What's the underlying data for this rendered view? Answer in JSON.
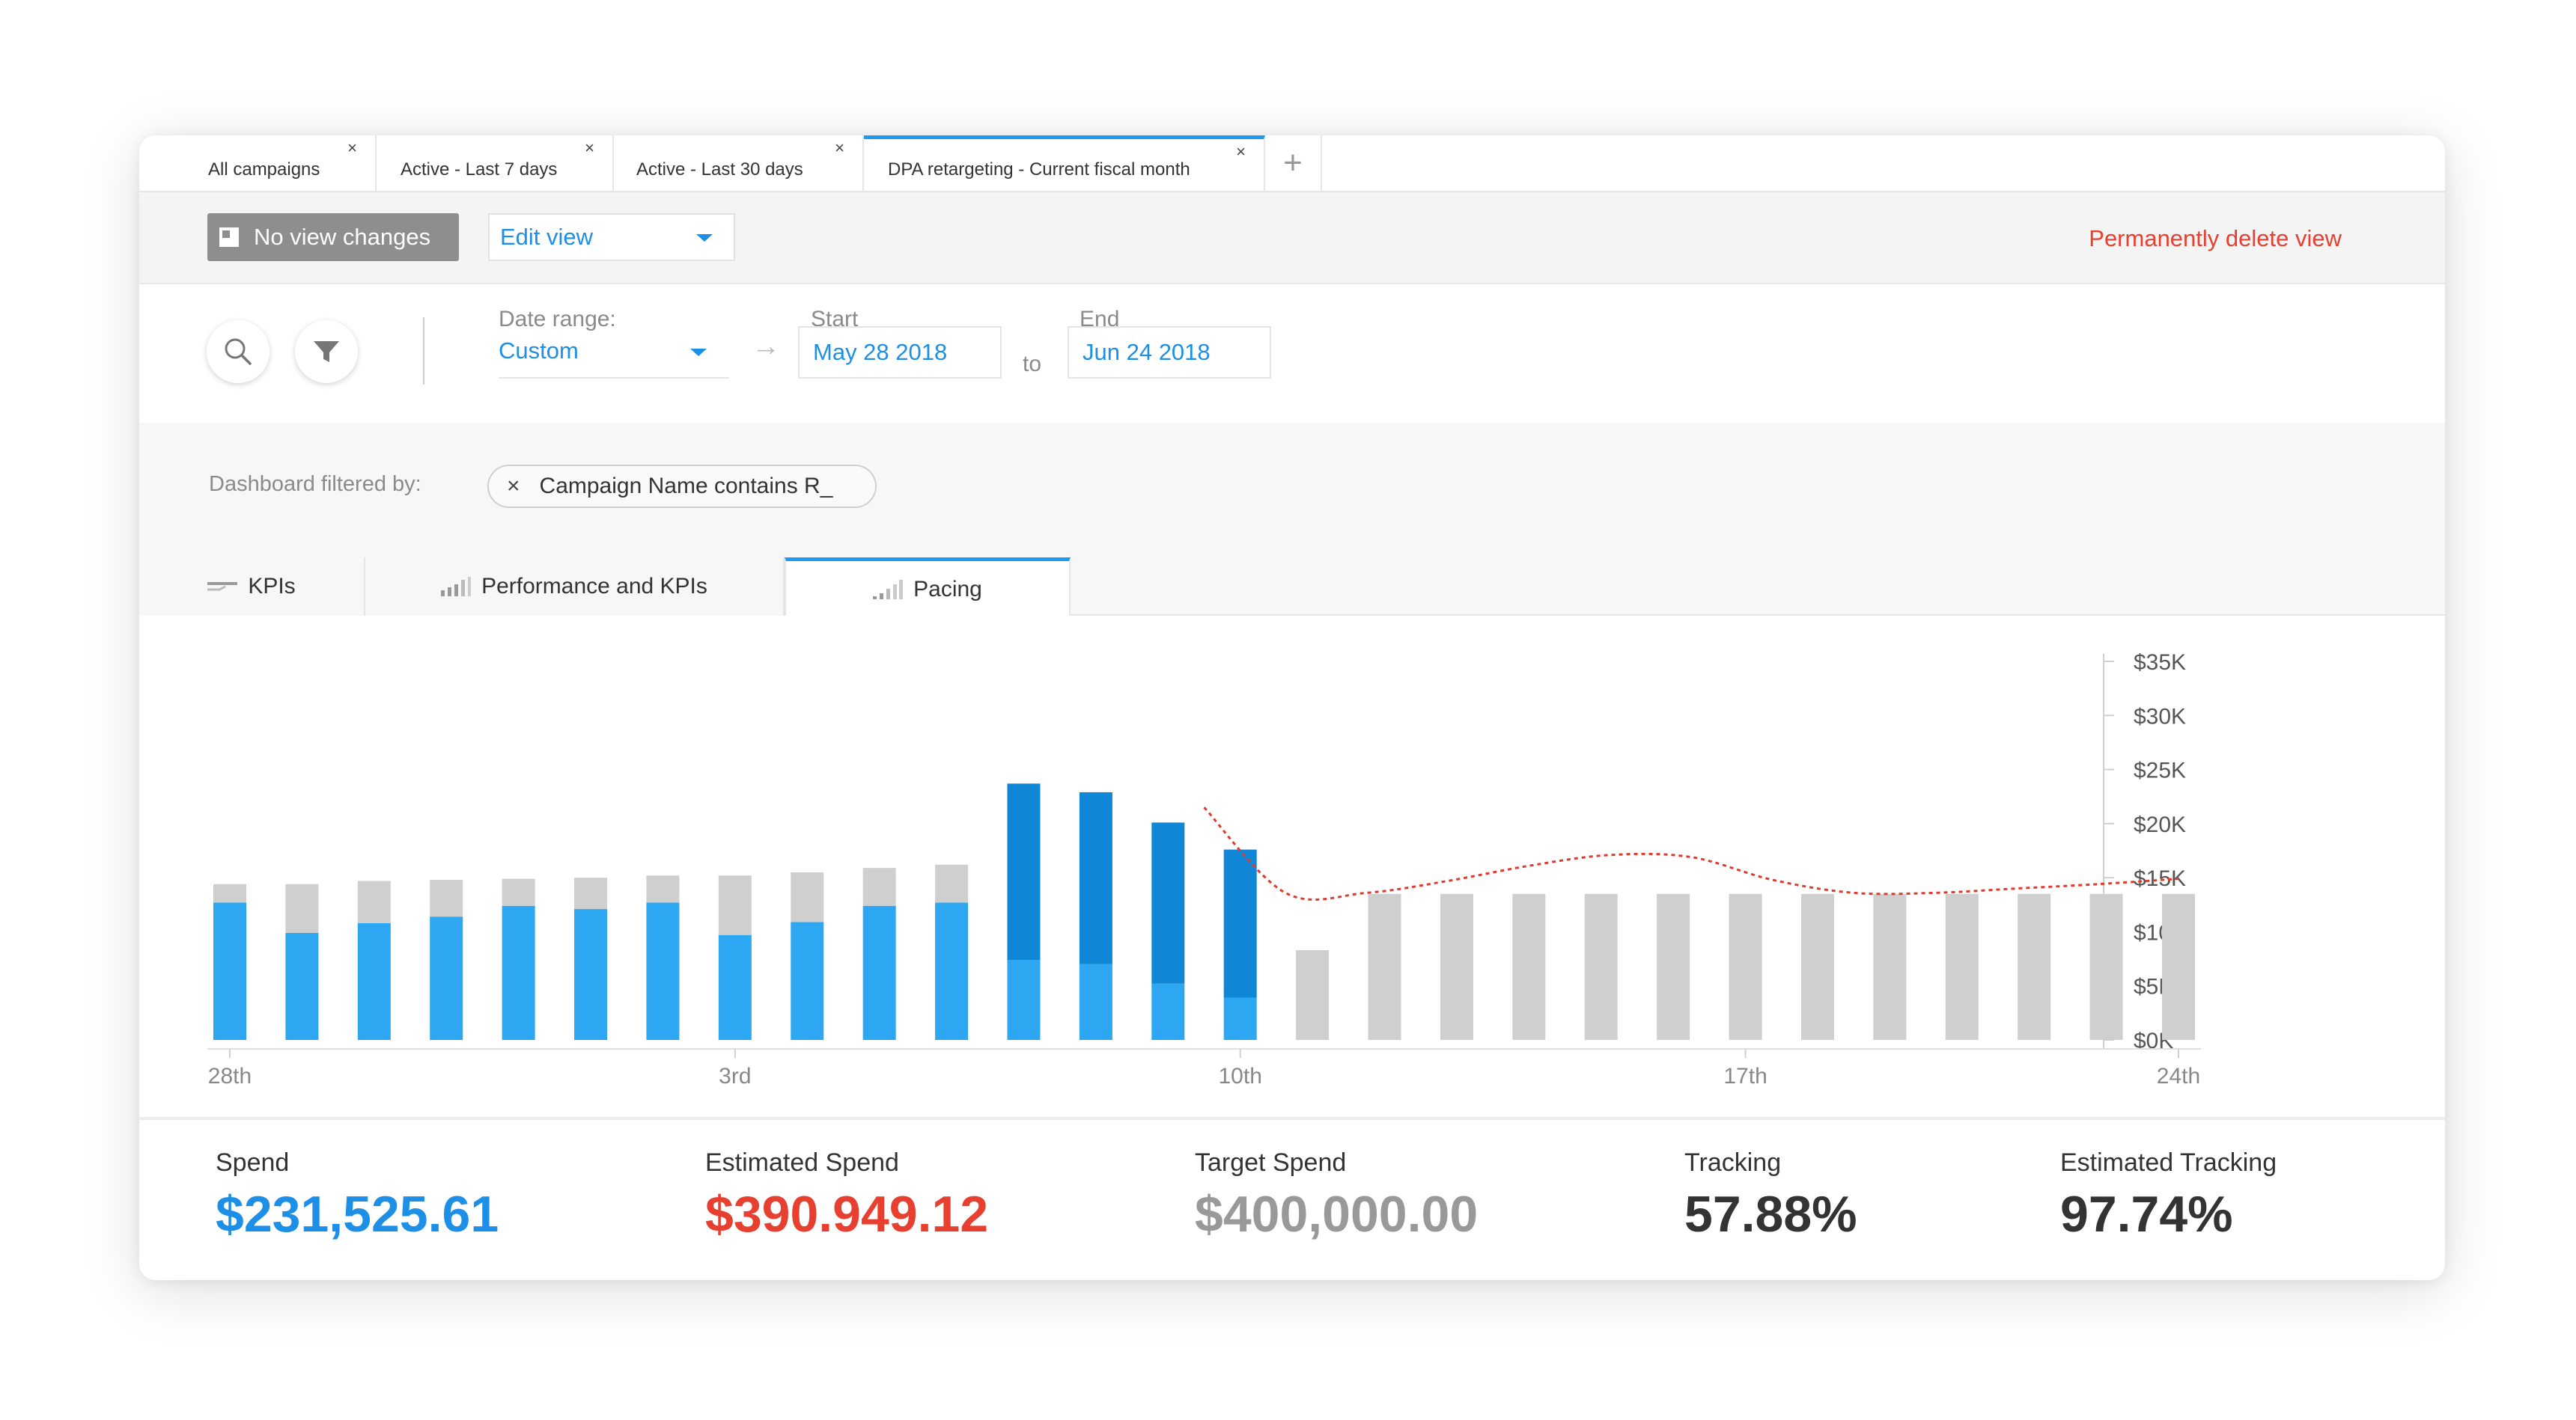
{
  "tabs": [
    {
      "label": "All campaigns",
      "close": "×"
    },
    {
      "label": "Active - Last 7 days",
      "close": "×"
    },
    {
      "label": "Active - Last 30 days",
      "close": "×"
    },
    {
      "label": "DPA retargeting - Current fiscal month",
      "close": "×"
    }
  ],
  "tab_add": "+",
  "toolbar": {
    "no_view_changes": "No view changes",
    "edit_view": "Edit view",
    "delete_view": "Permanently delete view"
  },
  "filters": {
    "date_range_label": "Date range:",
    "date_range_value": "Custom",
    "arrow": "→",
    "start_label": "Start",
    "start_value": "May 28 2018",
    "to": "to",
    "end_label": "End",
    "end_value": "Jun 24 2018"
  },
  "dashboard_filter": {
    "label": "Dashboard filtered by:",
    "chip_text": "Campaign Name contains R_",
    "chip_remove": "×"
  },
  "view_tabs": [
    {
      "label": "KPIs"
    },
    {
      "label": "Performance and KPIs"
    },
    {
      "label": "Pacing"
    }
  ],
  "colors": {
    "accent": "#1e9bf0",
    "bar_light_blue": "#2ea7f2",
    "bar_dark_blue": "#0f86d6",
    "bar_gray": "#cfcfcf",
    "forecast_red": "#e03a2e",
    "spend_blue": "#1e8fe6",
    "estimated_red": "#e84030",
    "target_gray": "#999999",
    "dark_text": "#333333"
  },
  "chart_data": {
    "type": "bar",
    "y_ticks": [
      "$0K",
      "$5K",
      "$10K",
      "$15K",
      "$20K",
      "$25K",
      "$30K",
      "$35K"
    ],
    "ylim": [
      0,
      35000
    ],
    "x_tick_labels": [
      {
        "index": 0,
        "label": "28th"
      },
      {
        "index": 7,
        "label": "3rd"
      },
      {
        "index": 14,
        "label": "10th"
      },
      {
        "index": 21,
        "label": "17th"
      },
      {
        "index": 27,
        "label": "24th"
      }
    ],
    "series": [
      {
        "values": [
          12700,
          9900,
          10800,
          11400,
          12400,
          12100,
          12700,
          9700,
          10900,
          12400,
          12700,
          7400,
          7000,
          5200,
          3900,
          0,
          0,
          0,
          0,
          0,
          0,
          0,
          0,
          0,
          0,
          0,
          0,
          0
        ]
      },
      {
        "values": [
          0,
          0,
          0,
          0,
          0,
          0,
          0,
          0,
          0,
          0,
          0,
          16300,
          15900,
          14900,
          13700,
          0,
          0,
          0,
          0,
          0,
          0,
          0,
          0,
          0,
          0,
          0,
          0,
          0
        ]
      },
      {
        "values": [
          1700,
          4500,
          3900,
          3400,
          2500,
          2900,
          2500,
          5500,
          4600,
          3500,
          3500,
          0,
          0,
          0,
          0,
          8300,
          13500,
          13500,
          13500,
          13500,
          13500,
          13500,
          13500,
          13500,
          13500,
          13500,
          13500,
          13500
        ]
      }
    ],
    "forecast_line": [
      21500,
      13600,
      13600,
      14700,
      16100,
      17100,
      16900,
      14800,
      13600,
      13600,
      14000,
      14400,
      14900
    ]
  },
  "stats": [
    {
      "label": "Spend",
      "value": "$231,525.61"
    },
    {
      "label": "Estimated Spend",
      "value": "$390.949.12"
    },
    {
      "label": "Target Spend",
      "value": "$400,000.00"
    },
    {
      "label": "Tracking",
      "value": "57.88%"
    },
    {
      "label": "Estimated Tracking",
      "value": "97.74%"
    }
  ]
}
